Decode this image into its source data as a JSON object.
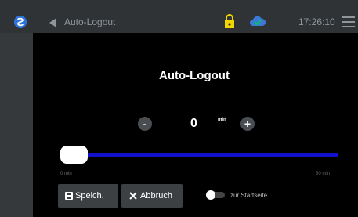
{
  "header": {
    "title": "Auto-Logout",
    "time": "17:26:10",
    "icons": [
      "logo-icon",
      "back-arrow-icon",
      "lock-icon",
      "cloud-check-icon",
      "menu-icon"
    ],
    "lock_color": "#f2d600",
    "cloud_color": "#3b7ad6"
  },
  "panel": {
    "heading": "Auto-Logout",
    "value": "0",
    "unit": "min",
    "decrement_label": "-",
    "increment_label": "+",
    "slider": {
      "min_label": "0 min",
      "max_label": "60 min",
      "value": 0,
      "min": 0,
      "max": 60,
      "track_color": "#1111cc"
    }
  },
  "actions": {
    "save_label": "Speich.",
    "cancel_label": "Abbruch",
    "toggle_label": "zur Startseite",
    "toggle_on": false
  }
}
